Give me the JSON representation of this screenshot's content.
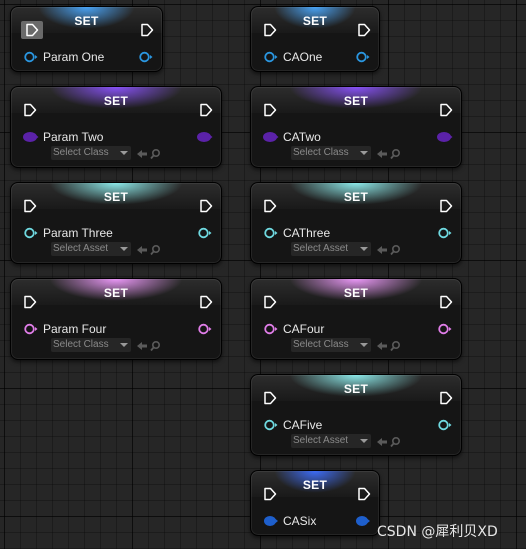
{
  "nodes": [
    {
      "id": "n1",
      "title": "SET",
      "var_name": "Param One",
      "pin": "object",
      "color": "#2a96e0",
      "glow": "#4aa9ff",
      "asset_picker": null
    },
    {
      "id": "n2",
      "title": "SET",
      "var_name": "CAOne",
      "pin": "object",
      "color": "#2a96e0",
      "glow": "#4aa9ff",
      "asset_picker": null
    },
    {
      "id": "n3",
      "title": "SET",
      "var_name": "Param Two",
      "pin": "class",
      "color": "#5b22a8",
      "glow": "#8b52ff",
      "asset_picker": "Select Class"
    },
    {
      "id": "n4",
      "title": "SET",
      "var_name": "CATwo",
      "pin": "class",
      "color": "#5b22a8",
      "glow": "#8b52ff",
      "asset_picker": "Select Class"
    },
    {
      "id": "n5",
      "title": "SET",
      "var_name": "Param Three",
      "pin": "soft-object",
      "color": "#6fd9e0",
      "glow": "#8ff0f0",
      "asset_picker": "Select Asset"
    },
    {
      "id": "n6",
      "title": "SET",
      "var_name": "CAThree",
      "pin": "soft-object",
      "color": "#6fd9e0",
      "glow": "#8ff0f0",
      "asset_picker": "Select Asset"
    },
    {
      "id": "n7",
      "title": "SET",
      "var_name": "Param Four",
      "pin": "soft-class",
      "color": "#e07de8",
      "glow": "#f29cff",
      "asset_picker": "Select Class"
    },
    {
      "id": "n8",
      "title": "SET",
      "var_name": "CAFour",
      "pin": "soft-class",
      "color": "#e07de8",
      "glow": "#f29cff",
      "asset_picker": "Select Class"
    },
    {
      "id": "n9",
      "title": "SET",
      "var_name": "CAFive",
      "pin": "soft-object",
      "color": "#6fd9e0",
      "glow": "#8ff0f0",
      "asset_picker": "Select Asset"
    },
    {
      "id": "n10",
      "title": "SET",
      "var_name": "CASix",
      "pin": "object-ref",
      "color": "#1e5fcc",
      "glow": "#3d6eff",
      "asset_picker": null
    }
  ],
  "icons": {
    "exec": "exec-pin-icon",
    "use_selected": "arrow-left-icon",
    "browse": "search-icon",
    "dropdown": "chevron-down-icon"
  },
  "watermark": "CSDN @犀利贝XD"
}
